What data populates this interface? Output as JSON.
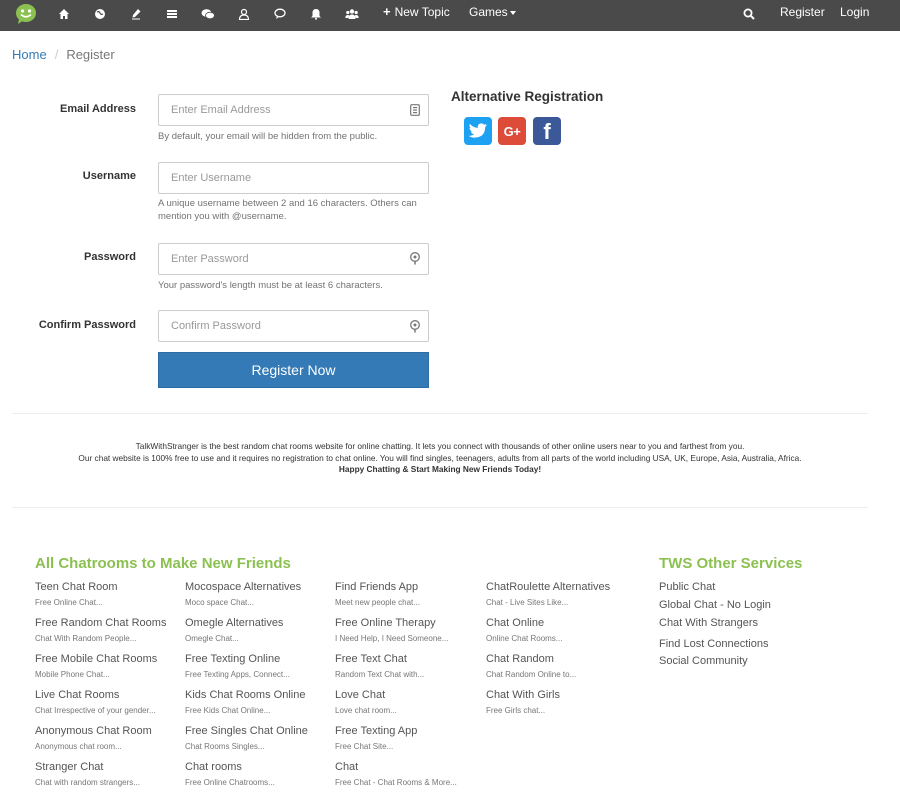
{
  "navbar": {
    "logo_icon": "smiley-chat-logo-icon",
    "icons": [
      "home-icon",
      "globe-icon",
      "pen-icon",
      "list-icon",
      "chat-bubbles-icon",
      "user-icon",
      "comment-icon",
      "bell-icon",
      "users-icon"
    ],
    "new_topic": "New Topic",
    "games": "Games",
    "search_icon": "search-icon",
    "register": "Register",
    "login": "Login",
    "bg_color": "#4a4a4a"
  },
  "breadcrumb": {
    "home": "Home",
    "separator": "/",
    "current": "Register"
  },
  "form": {
    "email": {
      "label": "Email Address",
      "placeholder": "Enter Email Address",
      "help": "By default, your email will be hidden from the public."
    },
    "username": {
      "label": "Username",
      "placeholder": "Enter Username",
      "help": "A unique username between 2 and 16 characters. Others can mention you with @username."
    },
    "password": {
      "label": "Password",
      "placeholder": "Enter Password",
      "help": "Your password's length must be at least 6 characters."
    },
    "confirm": {
      "label": "Confirm Password",
      "placeholder": "Confirm Password"
    },
    "submit": "Register Now",
    "accent": "#337ab7"
  },
  "alt_registration": {
    "title": "Alternative Registration",
    "providers": [
      {
        "name": "twitter",
        "color": "#1da1f2",
        "icon": "twitter-icon"
      },
      {
        "name": "google-plus",
        "color": "#dd4b39",
        "icon": "google-plus-icon",
        "text": "G+"
      },
      {
        "name": "facebook",
        "color": "#3b5998",
        "icon": "facebook-icon",
        "text": "f"
      }
    ]
  },
  "about": {
    "line1": "TalkWithStranger is the best random chat rooms website for online chatting. It lets you connect with thousands of other online users near to you and farthest from you.",
    "line2": "Our chat website is 100% free to use and it requires no registration to chat online. You will find singles, teenagers, adults from all parts of the world including USA, UK, Europe, Asia, Australia, Africa.",
    "line3": "Happy Chatting & Start Making New Friends Today!"
  },
  "footer": {
    "chatrooms_title": "All Chatrooms to Make New Friends",
    "title_color": "#8cc152",
    "columns": [
      [
        {
          "title": "Teen Chat Room",
          "sub": "Free Online Chat..."
        },
        {
          "title": "Free Random Chat Rooms",
          "sub": "Chat With Random People..."
        },
        {
          "title": "Free Mobile Chat Rooms",
          "sub": "Mobile Phone Chat..."
        },
        {
          "title": "Live Chat Rooms",
          "sub": "Chat Irrespective of your gender..."
        },
        {
          "title": "Anonymous Chat Room",
          "sub": "Anonymous chat room..."
        },
        {
          "title": "Stranger Chat",
          "sub": "Chat with random strangers..."
        }
      ],
      [
        {
          "title": "Mocospace Alternatives",
          "sub": "Moco space Chat..."
        },
        {
          "title": "Omegle Alternatives",
          "sub": "Omegle Chat..."
        },
        {
          "title": "Free Texting Online",
          "sub": "Free Texting Apps, Connect..."
        },
        {
          "title": "Kids Chat Rooms Online",
          "sub": "Free Kids Chat Online..."
        },
        {
          "title": "Free Singles Chat Online",
          "sub": "Chat Rooms Singles..."
        },
        {
          "title": "Chat rooms",
          "sub": "Free Online Chatrooms..."
        }
      ],
      [
        {
          "title": "Find Friends App",
          "sub": "Meet new people chat..."
        },
        {
          "title": "Free Online Therapy",
          "sub": "I Need Help, I Need Someone..."
        },
        {
          "title": "Free Text Chat",
          "sub": "Random Text Chat with..."
        },
        {
          "title": "Love Chat",
          "sub": "Love chat room..."
        },
        {
          "title": "Free Texting App",
          "sub": "Free Chat Site..."
        },
        {
          "title": "Chat",
          "sub": "Free Chat - Chat Rooms & More..."
        }
      ],
      [
        {
          "title": "ChatRoulette Alternatives",
          "sub": "Chat - Live Sites Like..."
        },
        {
          "title": "Chat Online",
          "sub": "Online Chat Rooms..."
        },
        {
          "title": "Chat Random",
          "sub": "Chat Random Online to..."
        },
        {
          "title": "Chat With Girls",
          "sub": "Free Girls chat..."
        }
      ]
    ],
    "services_title": "TWS Other Services",
    "services": [
      "Public Chat",
      "Global Chat - No Login",
      "Chat With Strangers",
      "Find Lost Connections",
      "Social Community"
    ]
  }
}
